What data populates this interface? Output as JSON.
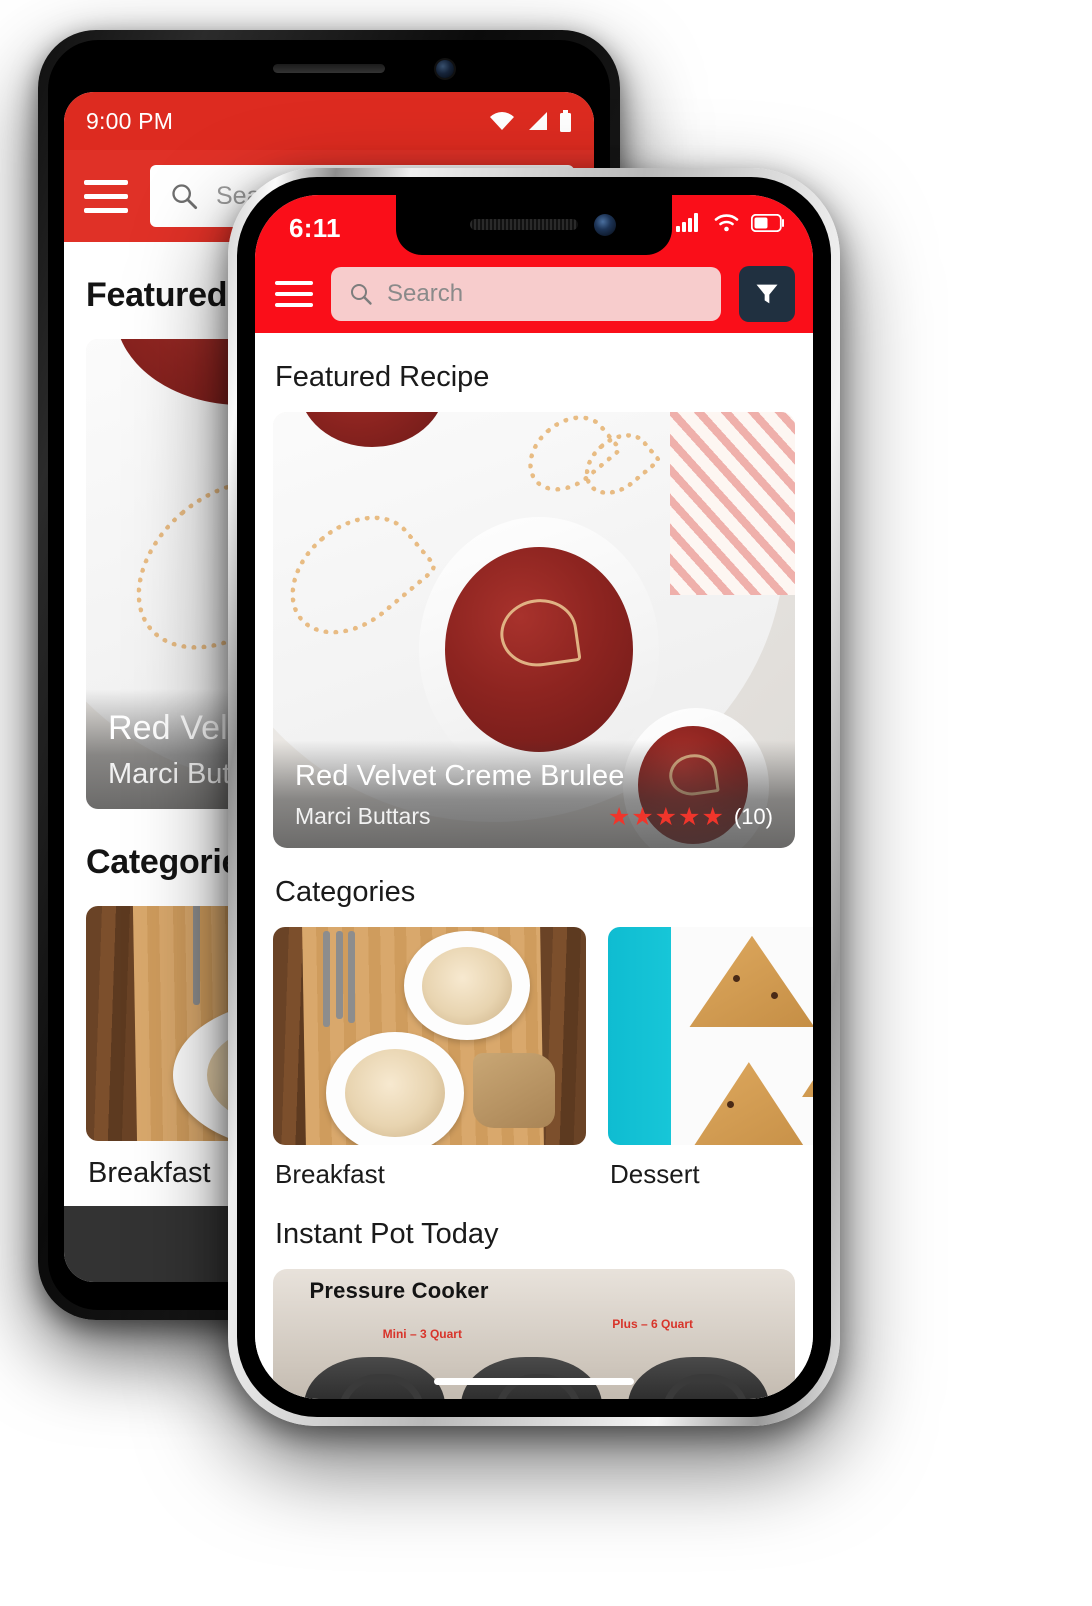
{
  "app": {
    "accent_red": "#FA0E19",
    "android_red": "#E03127",
    "filter_button_color": "#203040",
    "search_field_color": "#F7CCCC",
    "star_color": "#F0352B"
  },
  "android_phone": {
    "status": {
      "time": "9:00 PM",
      "icons": [
        "wifi-icon",
        "cell-signal-icon",
        "battery-icon"
      ]
    },
    "appbar": {
      "menu_icon": "hamburger-menu-icon",
      "search_placeholder": "Search",
      "search_icon": "search-icon"
    },
    "sections": {
      "featured_heading": "Featured Recipe",
      "categories_heading": "Categories"
    },
    "featured": {
      "title": "Red Velvet Creme Brulee",
      "author": "Marci Buttars"
    },
    "categories": [
      {
        "label": "Breakfast"
      }
    ],
    "navbar": {
      "back_icon": "back-chevron-icon",
      "back_label": "‹"
    }
  },
  "iphone": {
    "status": {
      "time": "6:11",
      "icons": [
        "cell-signal-icon",
        "wifi-icon",
        "battery-icon"
      ]
    },
    "appbar": {
      "menu_icon": "hamburger-menu-icon",
      "search_placeholder": "Search",
      "search_icon": "search-icon",
      "filter_icon": "filter-funnel-icon"
    },
    "sections": {
      "featured_heading": "Featured Recipe",
      "categories_heading": "Categories",
      "instant_pot_heading": "Instant Pot Today"
    },
    "featured": {
      "title": "Red Velvet Creme Brulee",
      "author": "Marci Buttars",
      "stars": "★★★★★",
      "rating_value": 5,
      "review_count": "(10)"
    },
    "categories": [
      {
        "label": "Breakfast",
        "image_alt": "breakfast-bowls-on-wooden-board"
      },
      {
        "label": "Dessert",
        "image_alt": "chocolate-chip-scones"
      }
    ],
    "instant_pot": {
      "image_title": "Pressure Cooker",
      "image_label_left": "Mini – 3 Quart",
      "image_label_right": "Plus – 6 Quart"
    },
    "home_indicator": "home-indicator-bar"
  }
}
